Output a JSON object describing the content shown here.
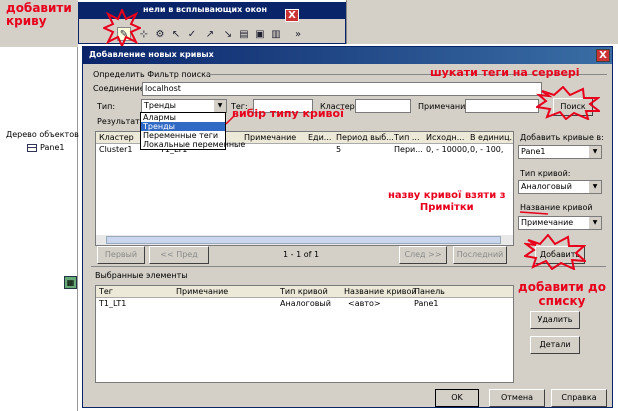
{
  "annotations": {
    "add_curve": "добавити криву",
    "search_tags": "шукати теги на сервері",
    "curve_type": "вибір типу кривої",
    "curve_name_line1": "назву кривої взяти з",
    "curve_name_line2": "Примітки",
    "add_to_list": "добавити до списку"
  },
  "toolbar": {
    "title": "нели в всплывающих окон",
    "close": "X",
    "more": "»"
  },
  "left_panel": {
    "tree_label": "Дерево объектов",
    "pane": "Pane1"
  },
  "dialog": {
    "title": "Добавление новых кривых",
    "close": "X",
    "filter_title": "Определить Фильтр поиска",
    "connection_label": "Соединение:",
    "connection_value": "localhost",
    "type_label": "Тип:",
    "type_value": "Тренды",
    "tag_label": "Тег:",
    "cluster_label": "Кластер",
    "note_label": "Примечание",
    "search_button": "Поиск",
    "type_options": [
      "Алармы",
      "Тренды",
      "Переменные теги",
      "Локальные переменные"
    ],
    "results_label": "Результаты",
    "results_headers": [
      "Кластер",
      "",
      "Примечание",
      "Еди...",
      "Период выб...",
      "Тип ...",
      "Исходн...",
      "В единиц..."
    ],
    "results_rows": [
      [
        "Cluster1",
        "T1_LT1",
        "",
        "",
        "5",
        "Пери...",
        "0, - 10000,",
        "0, - 100,"
      ]
    ],
    "nav": {
      "first": "Первый",
      "prev": "<< Пред",
      "page": "1 - 1 of 1",
      "next": "След >>",
      "last": "Последний"
    },
    "add_to_label": "Добавить кривые в:",
    "add_to_value": "Pane1",
    "curve_type_label": "Тип кривой:",
    "curve_type_value": "Аналоговый",
    "curve_name_label": "Название кривой",
    "curve_name_value": "Примечание",
    "add_button": "Добавить",
    "selected_label": "Выбранные элементы",
    "selected_headers": [
      "Тег",
      "Примечание",
      "Тип кривой",
      "Название кривой",
      "Панель"
    ],
    "selected_rows": [
      [
        "T1_LT1",
        "",
        "Аналоговый",
        "<авто>",
        "Pane1"
      ]
    ],
    "delete_button": "Удалить",
    "details_button": "Детали",
    "ok": "OK",
    "cancel": "Отмена",
    "help": "Справка"
  },
  "colors": {
    "annotation": "#e8001c",
    "title_bar": "#0a246a",
    "selection": "#316ac5"
  }
}
